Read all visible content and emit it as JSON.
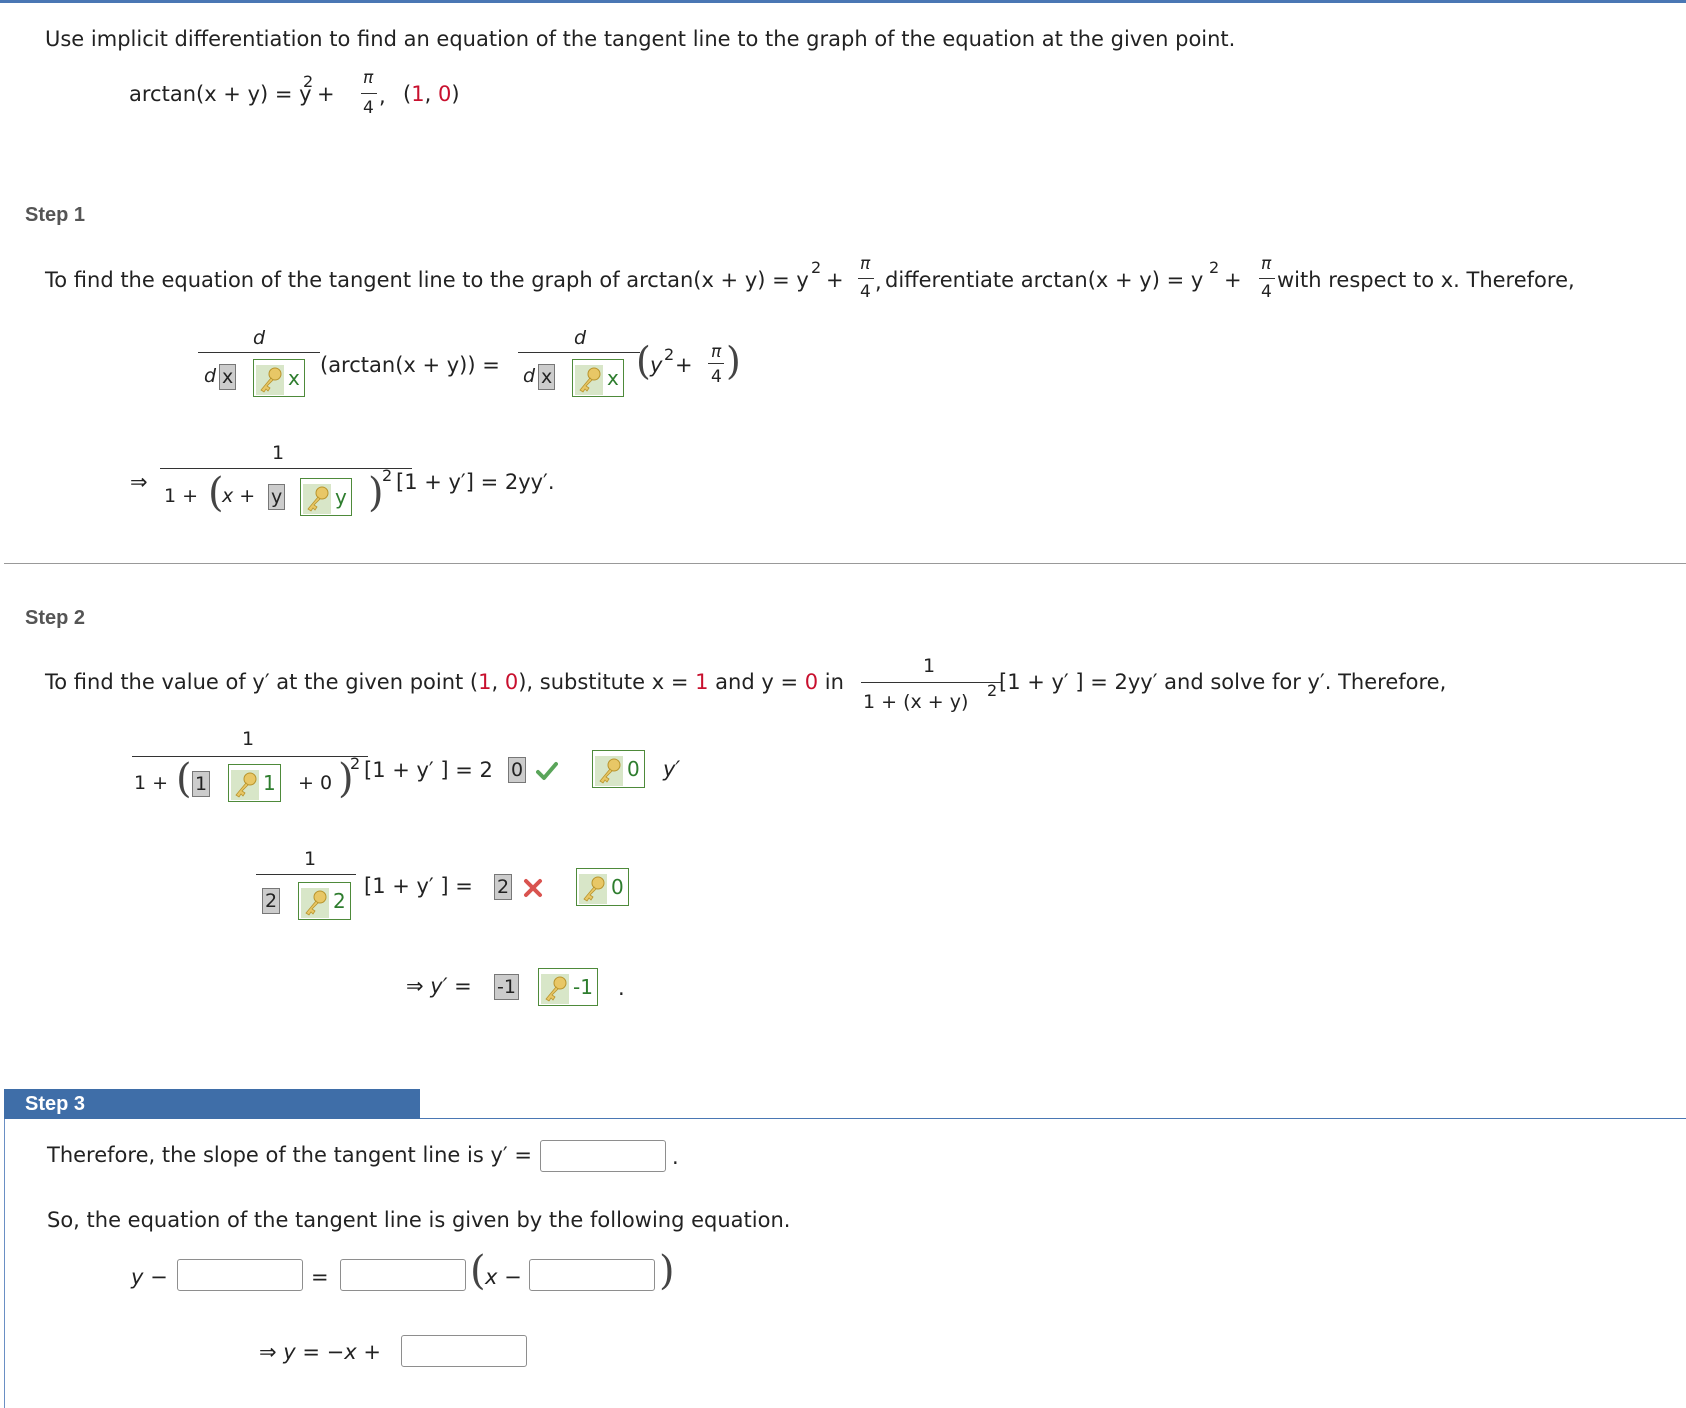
{
  "problem": {
    "instruction": "Use implicit differentiation to find an equation of the tangent line to the graph of the equation at the given point.",
    "equation_lhs": "arctan(x + y) = y",
    "sup2": "2",
    "plus": " + ",
    "pi": "π",
    "four": "4",
    "comma": ",",
    "point_open": "(",
    "point_x": "1",
    "point_sep": ", ",
    "point_y": "0",
    "point_close": ")"
  },
  "step1": {
    "label": "Step 1",
    "intro_a": "To find the equation of the tangent line to the graph of arctan(x + y) = y",
    "intro_b": " differentiate arctan(x + y) = y",
    "intro_c": " with respect to x. Therefore,",
    "d": "d",
    "dx_d": "d",
    "given_x": "x",
    "key_x": "x",
    "arctan_expr": "(arctan(x + y))  =",
    "rhs_y": "y",
    "rhs_plus": " + ",
    "implies": "⇒",
    "one": "1",
    "one_plus": "1 + ",
    "x_plus": "x + ",
    "given_y": "y",
    "key_y": "y",
    "tail": "[1 + y′]  =  2yy′."
  },
  "step2": {
    "label": "Step 2",
    "intro_a": "To find the value of y′ at the given point (",
    "intro_x": "1",
    "intro_sep": ", ",
    "intro_y": "0",
    "intro_b": "), substitute x = ",
    "intro_x2": "1",
    "intro_c": " and y = ",
    "intro_y2": "0",
    "intro_d": " in",
    "intro_den": "1 + (x + y)",
    "intro_e": "[1 + y′ ]  = 2yy′ and solve for y′. Therefore,",
    "row1_one_plus": "1 + ",
    "row1_given": "1",
    "row1_key": "1",
    "row1_plus0": " + 0",
    "row1_tail": "[1 + y′ ]  =  2",
    "row1_given_r": "0",
    "row1_key_r": "0",
    "row1_yprime": "y′",
    "row2_given": "2",
    "row2_key": "2",
    "row2_tail": "[1 + y′ ]  =",
    "row2_given_r": "2",
    "row2_key_r": "0",
    "row3_lhs": "⇒ y′  =",
    "row3_given": "-1",
    "row3_key": "-1",
    "row3_period": "."
  },
  "step3": {
    "label": "Step 3",
    "slope_text": "Therefore, the slope of the tangent line is y′ =",
    "slope_period": ".",
    "eq_text": "So, the equation of the tangent line is given by the following equation.",
    "y_minus": "y −",
    "equals": "=",
    "x_minus": "x −",
    "final_lhs": "⇒ y  =  −x +"
  },
  "colors": {
    "accent": "#3f6ea8",
    "correct": "#5aa55a",
    "incorrect": "#d9534f"
  }
}
